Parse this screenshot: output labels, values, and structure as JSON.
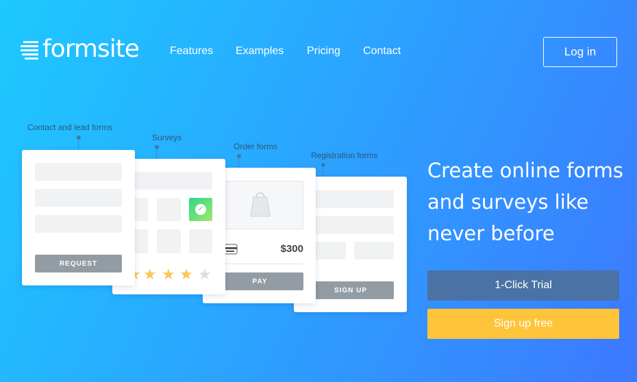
{
  "brand": {
    "name": "formsite"
  },
  "nav": {
    "items": [
      "Features",
      "Examples",
      "Pricing",
      "Contact"
    ],
    "login": "Log in"
  },
  "illustration": {
    "labels": [
      "Contact and lead forms",
      "Surveys",
      "Order forms",
      "Registration forms"
    ],
    "contact_button": "REQUEST",
    "order_price": "$300",
    "order_button": "PAY",
    "registration_button": "SIGN UP",
    "survey_rating": {
      "value": 4,
      "max": 5
    }
  },
  "hero": {
    "headline": "Create online forms and surveys like never before",
    "trial_button": "1-Click Trial",
    "signup_button": "Sign up free"
  },
  "colors": {
    "trial": "#4a72a4",
    "signup": "#ffc43a",
    "star": "#ffc457"
  }
}
